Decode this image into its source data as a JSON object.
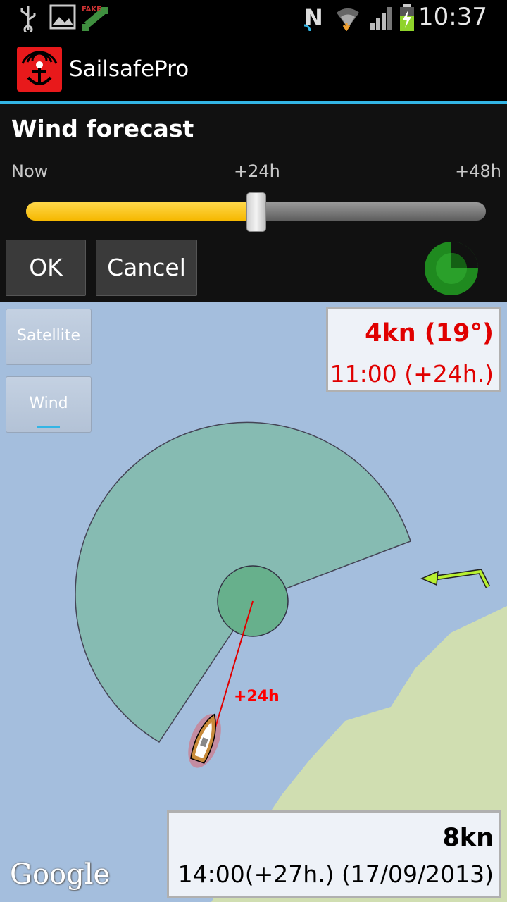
{
  "status_bar": {
    "time": "10:37",
    "icons": [
      "usb-icon",
      "image-icon",
      "fake-gps-icon",
      "n-icon",
      "wifi-icon",
      "signal-icon",
      "battery-charging-icon"
    ],
    "fake_label": "FAKE"
  },
  "app": {
    "title": "SailsafePro",
    "accent": "#33b5e5"
  },
  "dialog": {
    "title": "Wind forecast",
    "slider": {
      "labels": {
        "start": "Now",
        "middle": "+24h",
        "end": "+48h"
      },
      "value_fraction": 0.5
    },
    "buttons": {
      "ok": "OK",
      "cancel": "Cancel"
    }
  },
  "map": {
    "buttons": {
      "satellite": "Satellite",
      "wind": "Wind"
    },
    "wind_info": {
      "speed": "4kn (19°)",
      "time": "11:00 (+24h.)"
    },
    "track_label": "+24h",
    "bottom_info": {
      "speed": "8kn",
      "time": "14:00(+27h.) (17/09/2013)"
    },
    "attribution": "Google",
    "colors": {
      "sea": "#a4bedd",
      "land": "#d0deb1",
      "sector": "#86bbb2",
      "wind_arrow": "#b8f030"
    }
  }
}
